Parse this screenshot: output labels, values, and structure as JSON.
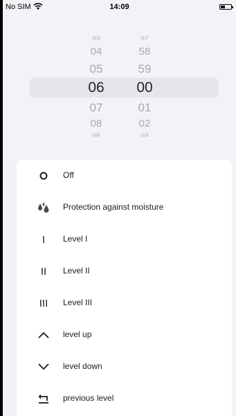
{
  "status_bar": {
    "carrier": "No SIM",
    "time": "14:09"
  },
  "time_picker": {
    "hours": [
      "03",
      "04",
      "05",
      "06",
      "07",
      "08",
      "09"
    ],
    "minutes": [
      "57",
      "58",
      "59",
      "00",
      "01",
      "02",
      "03"
    ],
    "selected_hour": "06",
    "selected_minute": "00"
  },
  "options": [
    {
      "icon": "off-circle-icon",
      "label": "Off"
    },
    {
      "icon": "moisture-drops-icon",
      "label": "Protection against moisture"
    },
    {
      "icon": "level-one-icon",
      "glyph": "I",
      "label": "Level I"
    },
    {
      "icon": "level-two-icon",
      "glyph": "II",
      "label": "Level II"
    },
    {
      "icon": "level-three-icon",
      "glyph": "III",
      "label": "Level III"
    },
    {
      "icon": "chevron-up-icon",
      "label": "level up"
    },
    {
      "icon": "chevron-down-icon",
      "label": "level down"
    },
    {
      "icon": "return-arrow-icon",
      "label": "previous level"
    }
  ]
}
